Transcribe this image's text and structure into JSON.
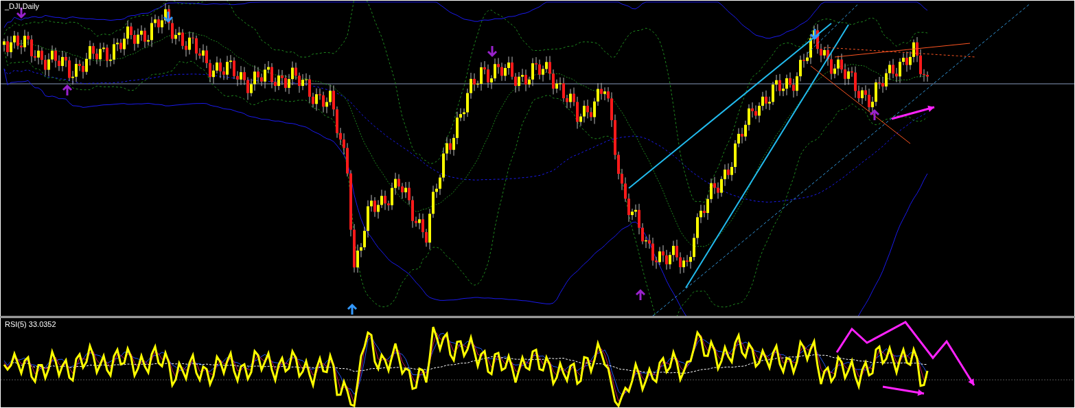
{
  "main_chart": {
    "symbol_label": "_DJI,Daily"
  },
  "rsi_panel": {
    "label": "RSI(5) 33.0352"
  }
}
